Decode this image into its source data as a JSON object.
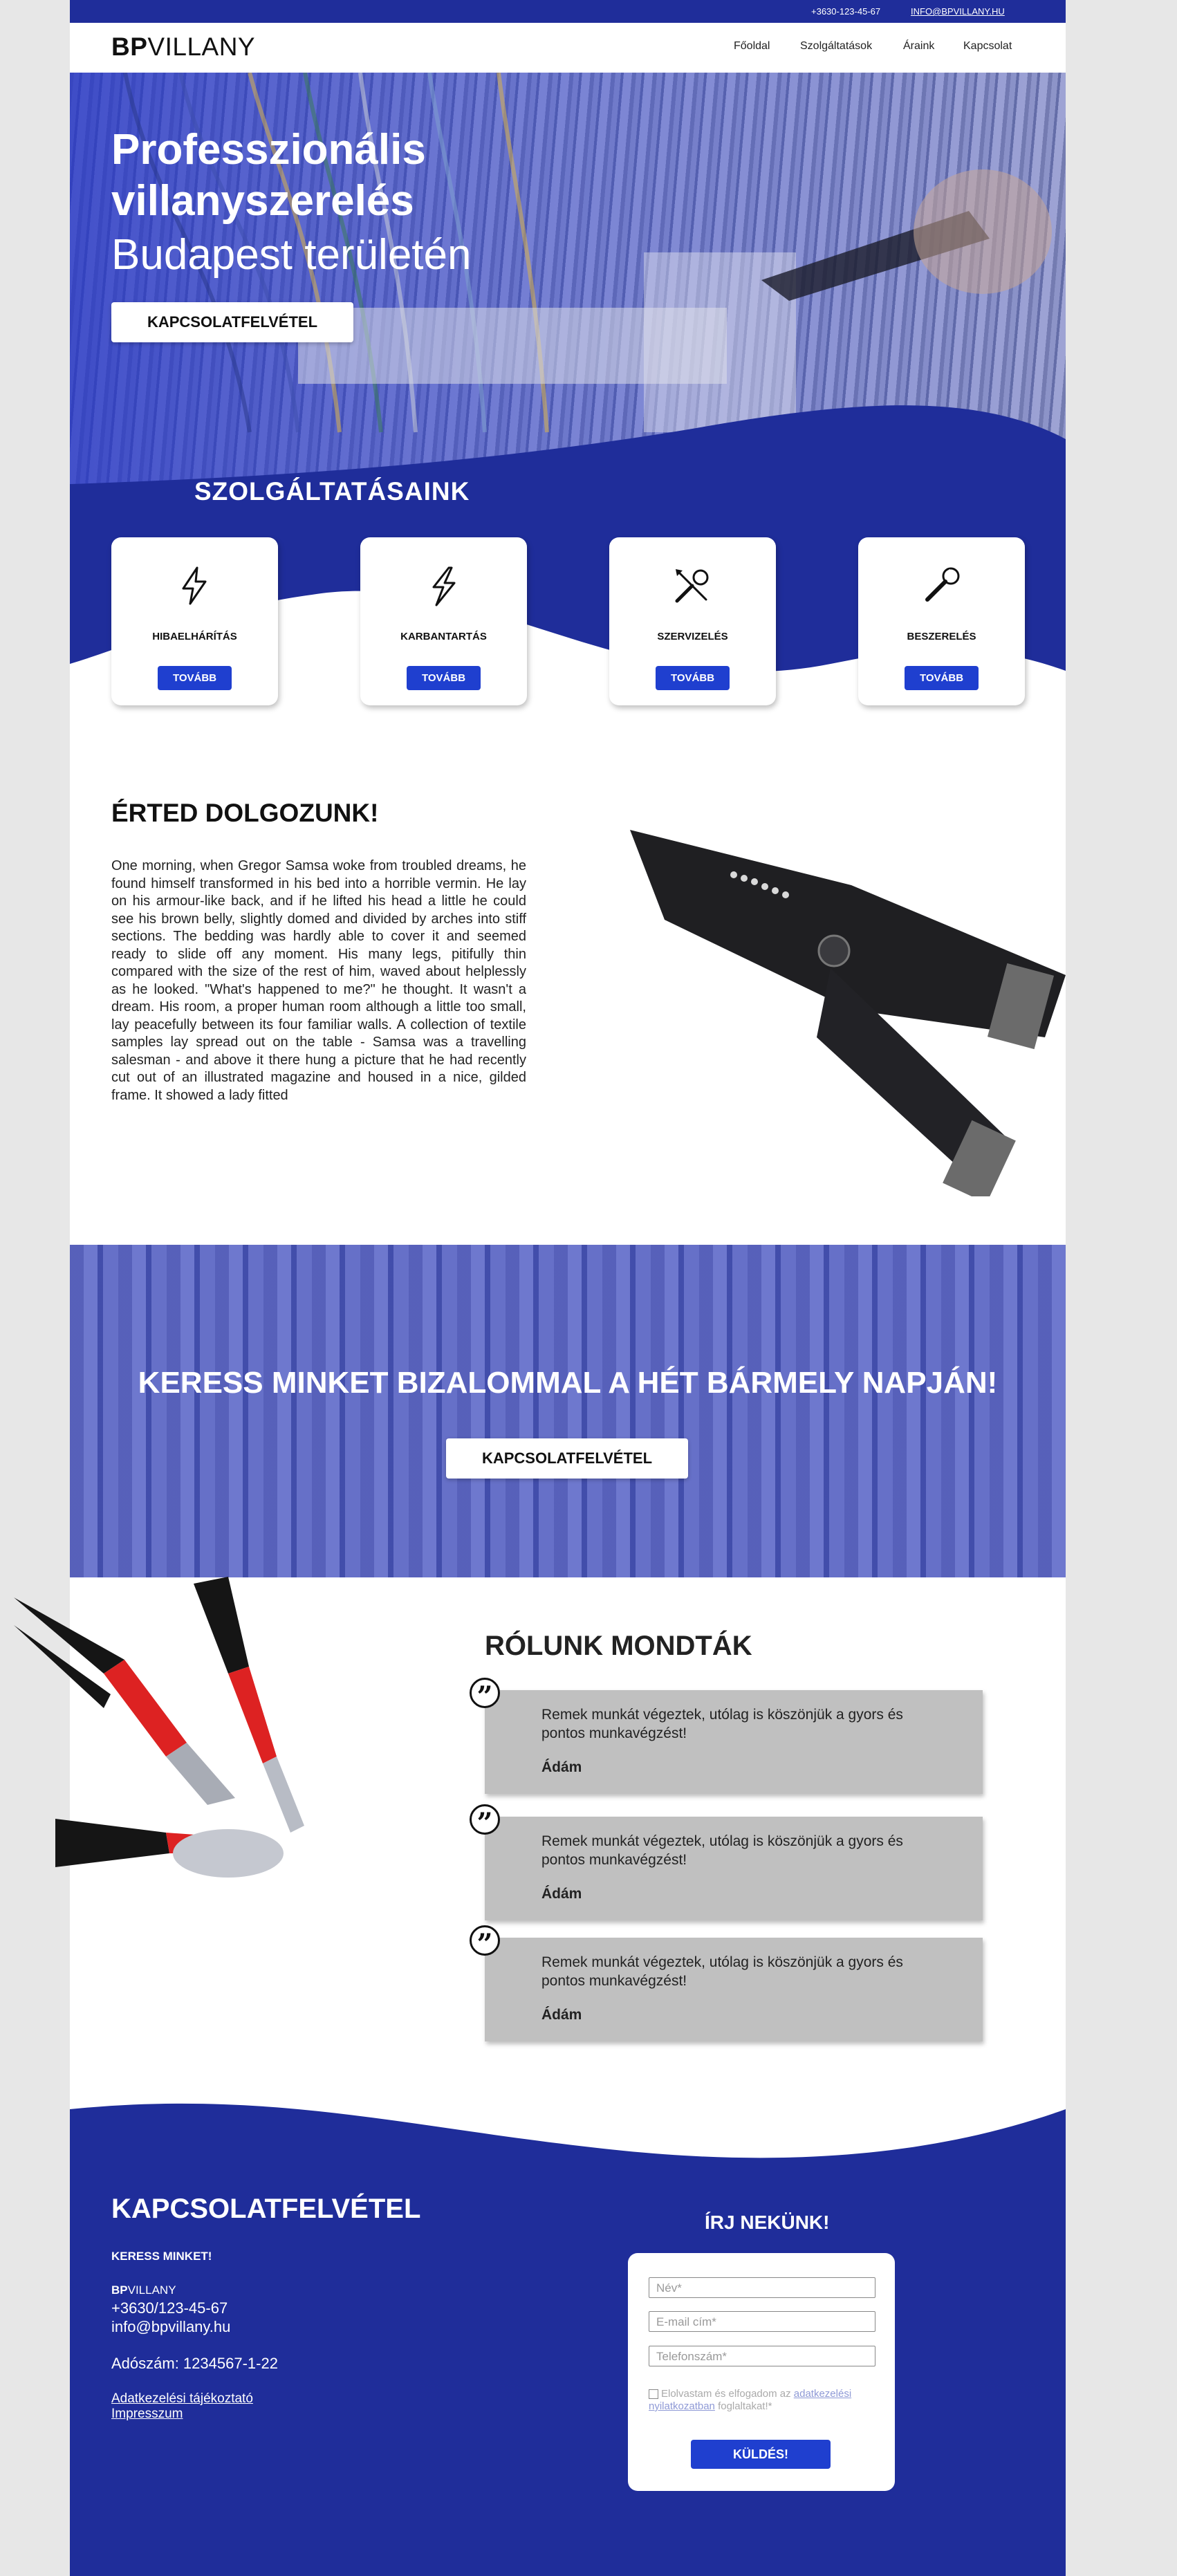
{
  "colors": {
    "brand": "#1f2d9a",
    "button": "#1f3fcf",
    "page_bg": "#e7e7e7",
    "review_bg": "#c0c0c0"
  },
  "topbar": {
    "phone": "+3630-123-45-67",
    "email": "INFO@BPVILLANY.HU"
  },
  "header": {
    "logo_bold": "BP",
    "logo_rest": "VILLANY",
    "menu": [
      "Főoldal",
      "Szolgáltatások",
      "Áraink",
      "Kapcsolat"
    ]
  },
  "hero": {
    "title_line1": "Professzionális",
    "title_line2": "villanyszerelés",
    "subtitle": "Budapest területén",
    "cta": "KAPCSOLATFELVÉTEL"
  },
  "services": {
    "title": "SZOLGÁLTATÁSAINK",
    "items": [
      {
        "label": "HIBAELHÁRÍTÁS",
        "button": "TOVÁBB",
        "icon": "lightning-icon"
      },
      {
        "label": "KARBANTARTÁS",
        "button": "TOVÁBB",
        "icon": "lightning-bolt-icon"
      },
      {
        "label": "SZERVIZELÉS",
        "button": "TOVÁBB",
        "icon": "tools-icon"
      },
      {
        "label": "BESZERELÉS",
        "button": "TOVÁBB",
        "icon": "wrench-icon"
      }
    ]
  },
  "about": {
    "title": "ÉRTED DOLGOZUNK!",
    "text": "One morning, when Gregor Samsa woke from troubled dreams, he found himself transformed in his bed into a horrible vermin. He lay on his armour-like back, and if he lifted his head a little he could see his brown belly, slightly domed and divided by arches into stiff sections. The bedding was hardly able to cover it and seemed ready to slide off any moment. His many legs, pitifully thin compared with the size of the rest of him, waved about helplessly as he looked. \"What's happened to me?\" he thought. It wasn't a dream. His room, a proper human room although a little too small, lay peacefully between its four familiar walls. A collection of textile samples lay spread out on the table - Samsa was a travelling salesman - and above it there hung a picture that he had recently cut out of an illustrated magazine and housed in a nice, gilded frame. It showed a lady fitted"
  },
  "cta_banner": {
    "title": "KERESS MINKET BIZALOMMAL A HÉT BÁRMELY NAPJÁN!",
    "button": "KAPCSOLATFELVÉTEL"
  },
  "reviews": {
    "title": "RÓLUNK MONDTÁK",
    "items": [
      {
        "text": "Remek munkát végeztek, utólag is köszönjük a gyors és pontos munkavégzést!",
        "author": "Ádám"
      },
      {
        "text": "Remek munkát végeztek, utólag is köszönjük a gyors és pontos munkavégzést!",
        "author": "Ádám"
      },
      {
        "text": "Remek munkát végeztek, utólag is köszönjük a gyors és pontos munkavégzést!",
        "author": "Ádám"
      }
    ]
  },
  "footer": {
    "title": "KAPCSOLATFELVÉTEL",
    "search_us": "KERESS MINKET!",
    "brand_bold": "BP",
    "brand_rest": "VILLANY",
    "phone": "+3630/123-45-67",
    "email": "info@bpvillany.hu",
    "tax": "Adószám: 1234567-1-22",
    "privacy_link": "Adatkezelési tájékoztató",
    "imprint_link": "Impresszum"
  },
  "form": {
    "title": "ÍRJ NEKÜNK!",
    "name_placeholder": "Név*",
    "email_placeholder": "E-mail cím*",
    "phone_placeholder": "Telefonszám*",
    "consent_pre": "Elolvastam és elfogadom az ",
    "consent_link": "adatkezelési nyilatkozatban",
    "consent_post": " foglaltakat!*",
    "submit": "KÜLDÉS!"
  }
}
